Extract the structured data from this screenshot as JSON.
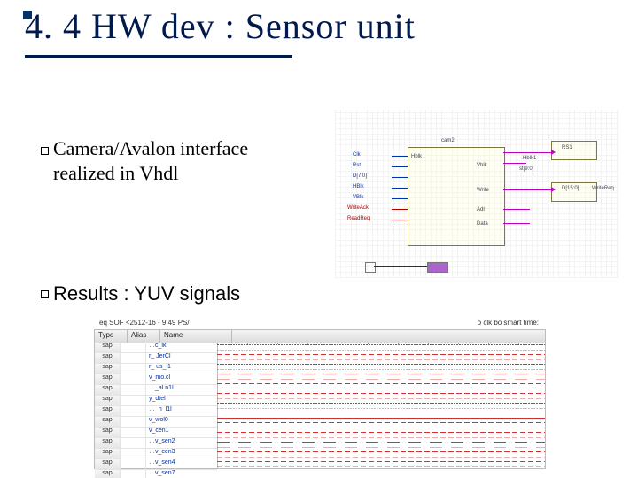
{
  "title": "4. 4 HW dev : Sensor unit",
  "bullets": {
    "b1": "Camera/Avalon interface realized in Vhdl",
    "b2": "Results : YUV signals"
  },
  "schematic": {
    "main_block": "cam2",
    "main_ports_left": [
      "Clk",
      "Rst",
      "D[7:0]",
      "HBlk",
      "VBlk",
      "WriteAck",
      "ReadReq"
    ],
    "main_ports_right": [
      "Hblk",
      "Vblk",
      "Write",
      "Adr",
      "Data"
    ],
    "right_labels": [
      "RS1",
      "Hblk1",
      "st[9:0]",
      "D[15:0]",
      "WriteReq"
    ]
  },
  "waveform": {
    "title": "eq SOF <2512-16 - 9:49 PS/",
    "clock_label": "o clk bo smart time:",
    "columns": [
      "Type",
      "Alias",
      "Name"
    ],
    "row_type": "sap",
    "signals": [
      {
        "name": "…c_lk",
        "style": "dense"
      },
      {
        "name": "r_ JerCl",
        "style": "med"
      },
      {
        "name": "r_ us_l1",
        "style": "dense"
      },
      {
        "name": "v_mo.cl",
        "style": "slow"
      },
      {
        "name": "…_al.n1l",
        "style": "med"
      },
      {
        "name": "y_dtel",
        "style": "med"
      },
      {
        "name": "…_n_l1l",
        "style": "dense"
      },
      {
        "name": "v_wol0",
        "style": "flat"
      },
      {
        "name": "v_cen1",
        "style": "med"
      },
      {
        "name": "…v_sen2",
        "style": "med"
      },
      {
        "name": "…v_cen3",
        "style": "slow"
      },
      {
        "name": "…v_sen4",
        "style": "med"
      },
      {
        "name": "…v_sen7",
        "style": "med"
      }
    ]
  }
}
